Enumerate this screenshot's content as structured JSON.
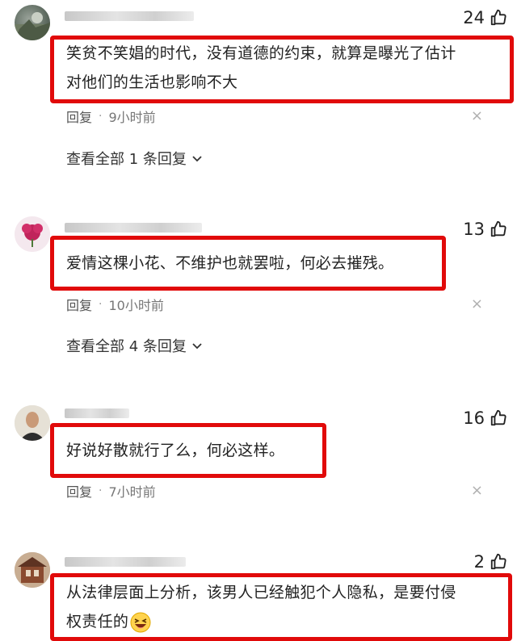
{
  "comments": [
    {
      "likes": "24",
      "text_lines": [
        "笑贫不笑娼的时代，没有道德的约束，就算是曝光了估计",
        "对他们的生活也影响不大"
      ],
      "reply_label": "回复",
      "separator": "·",
      "time": "9小时前",
      "close": "×",
      "view_all": "查看全部 1 条回复"
    },
    {
      "likes": "13",
      "text_lines": [
        "爱情这棵小花、不维护也就罢啦，何必去摧残。"
      ],
      "reply_label": "回复",
      "separator": "·",
      "time": "10小时前",
      "close": "×",
      "view_all": "查看全部 4 条回复"
    },
    {
      "likes": "16",
      "text_lines": [
        "好说好散就行了么，何必这样。"
      ],
      "reply_label": "回复",
      "separator": "·",
      "time": "7小时前",
      "close": "×"
    },
    {
      "likes": "2",
      "text_lines": [
        "从法律层面上分析，该男人已经触犯个人隐私，是要付侵",
        "权责任的"
      ],
      "emoji": "laughing-emoji"
    }
  ],
  "colors": {
    "highlight": "#e10a0a",
    "text": "#222222",
    "meta": "#555555"
  }
}
